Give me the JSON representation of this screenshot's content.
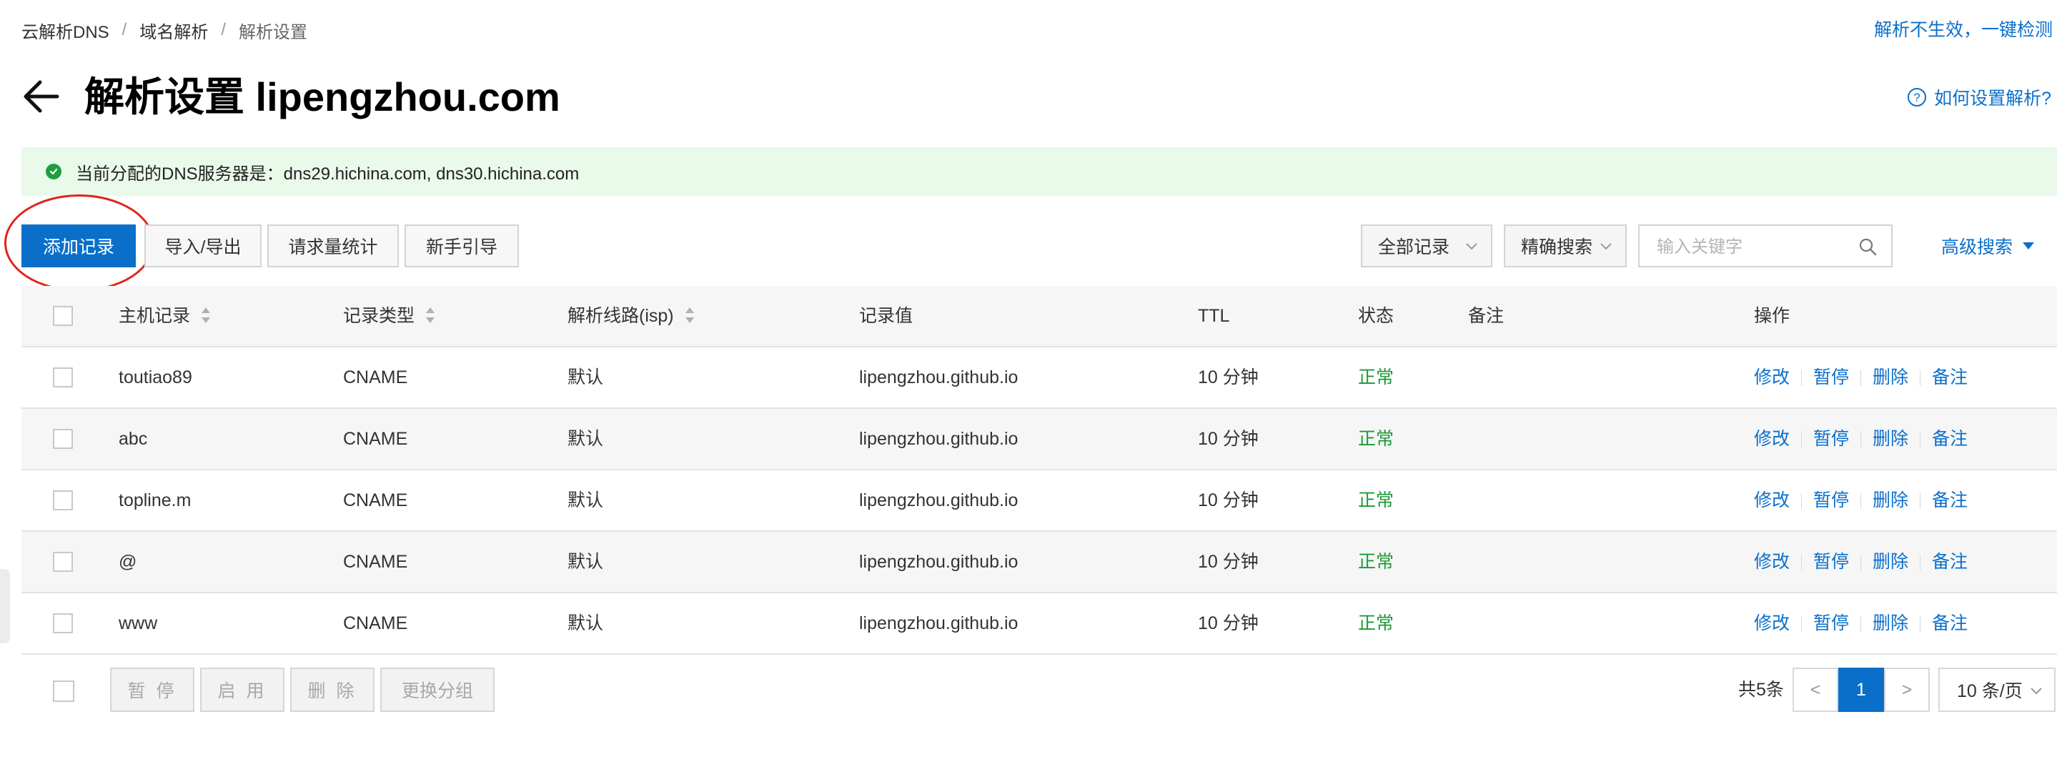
{
  "breadcrumb": [
    "云解析DNS",
    "域名解析",
    "解析设置"
  ],
  "top_link": "解析不生效，一键检测",
  "title": "解析设置 lipengzhou.com",
  "help_link": "如何设置解析?",
  "notice": "当前分配的DNS服务器是：dns29.hichina.com, dns30.hichina.com",
  "toolbar": {
    "add_record": "添加记录",
    "import_export": "导入/导出",
    "request_stats": "请求量统计",
    "beginner_guide": "新手引导",
    "record_filter": "全部记录",
    "search_mode": "精确搜索",
    "search_placeholder": "输入关键字",
    "advanced_search": "高级搜索"
  },
  "table": {
    "columns": [
      "主机记录",
      "记录类型",
      "解析线路(isp)",
      "记录值",
      "TTL",
      "状态",
      "备注",
      "操作"
    ],
    "rows": [
      {
        "host": "toutiao89",
        "type": "CNAME",
        "line": "默认",
        "value": "lipengzhou.github.io",
        "ttl": "10 分钟",
        "status": "正常",
        "note": ""
      },
      {
        "host": "abc",
        "type": "CNAME",
        "line": "默认",
        "value": "lipengzhou.github.io",
        "ttl": "10 分钟",
        "status": "正常",
        "note": ""
      },
      {
        "host": "topline.m",
        "type": "CNAME",
        "line": "默认",
        "value": "lipengzhou.github.io",
        "ttl": "10 分钟",
        "status": "正常",
        "note": ""
      },
      {
        "host": "@",
        "type": "CNAME",
        "line": "默认",
        "value": "lipengzhou.github.io",
        "ttl": "10 分钟",
        "status": "正常",
        "note": ""
      },
      {
        "host": "www",
        "type": "CNAME",
        "line": "默认",
        "value": "lipengzhou.github.io",
        "ttl": "10 分钟",
        "status": "正常",
        "note": ""
      }
    ],
    "actions": [
      "修改",
      "暂停",
      "删除",
      "备注"
    ]
  },
  "bulk": {
    "pause": "暂 停",
    "enable": "启 用",
    "delete": "删 除",
    "change_group": "更换分组"
  },
  "pagination": {
    "total": "共5条",
    "current_page": "1",
    "prev": "<",
    "next": ">",
    "page_size": "10 条/页"
  },
  "colors": {
    "primary": "#0a6fc9",
    "link": "#0b6fcc",
    "status_ok": "#1a9a37",
    "notice_bg": "#e9f9ea",
    "highlight_circle": "#e0231b"
  }
}
